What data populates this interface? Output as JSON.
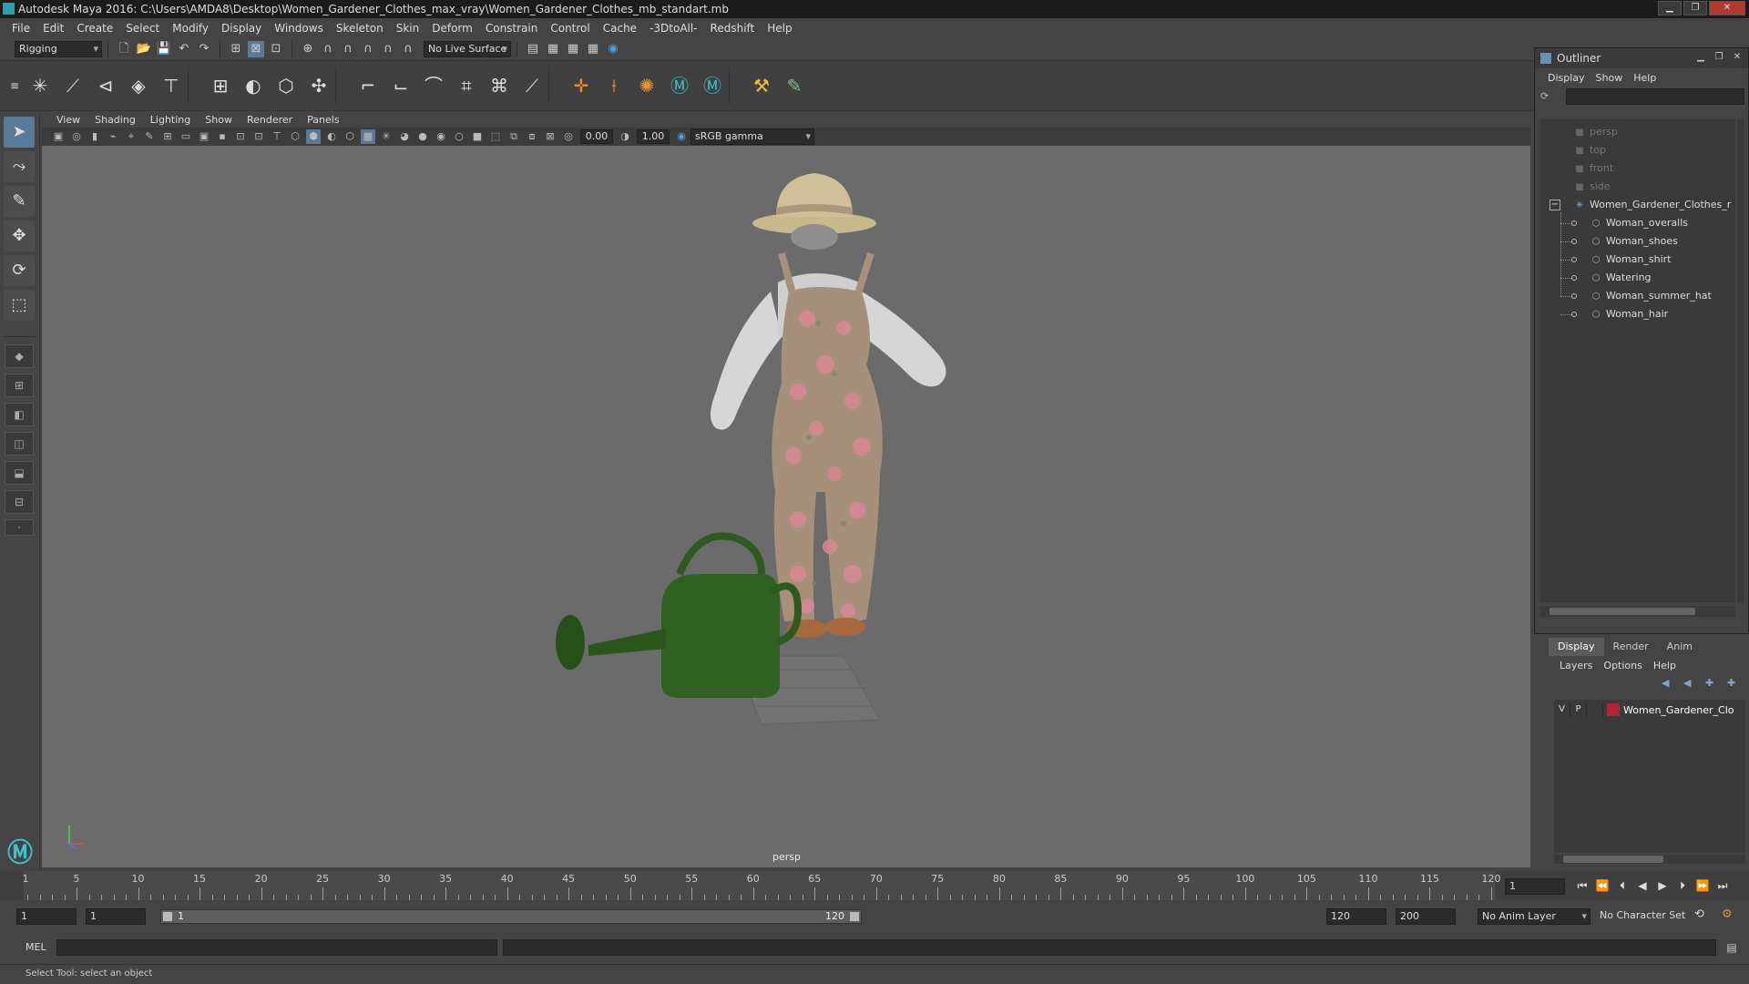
{
  "window": {
    "title": "Autodesk Maya 2016: C:\\Users\\AMDA8\\Desktop\\Women_Gardener_Clothes_max_vray\\Women_Gardener_Clothes_mb_standart.mb"
  },
  "menubar": [
    "File",
    "Edit",
    "Create",
    "Select",
    "Modify",
    "Display",
    "Windows",
    "Skeleton",
    "Skin",
    "Deform",
    "Constrain",
    "Control",
    "Cache",
    "-3DtoAll-",
    "Redshift",
    "Help"
  ],
  "statusline": {
    "menuset": "Rigging",
    "live_surface": "No Live Surface"
  },
  "panel": {
    "menus": [
      "View",
      "Shading",
      "Lighting",
      "Show",
      "Renderer",
      "Panels"
    ],
    "exposure": "0.00",
    "gamma": "1.00",
    "colorspace": "sRGB gamma",
    "camera_label": "persp"
  },
  "timeline": {
    "ticks": [
      "5",
      "10",
      "15",
      "20",
      "25",
      "30",
      "35",
      "40",
      "45",
      "50",
      "55",
      "60",
      "65",
      "70",
      "75",
      "80",
      "85",
      "90",
      "95",
      "100",
      "105",
      "110",
      "115",
      "120"
    ],
    "current_frame": "1"
  },
  "range": {
    "start": "1",
    "playback_start": "1",
    "slider_start": "1",
    "slider_end": "120",
    "playback_end": "120",
    "end": "200",
    "anim_layer": "No Anim Layer",
    "character_set": "No Character Set"
  },
  "mel": {
    "label": "MEL"
  },
  "status": {
    "help_line": "Select Tool: select an object"
  },
  "outliner": {
    "title": "Outliner",
    "menus": [
      "Display",
      "Show",
      "Help"
    ],
    "cameras": [
      "persp",
      "top",
      "front",
      "side"
    ],
    "group": "Women_Gardener_Clothes_r",
    "children": [
      "Woman_overalls",
      "Woman_shoes",
      "Woman_shirt",
      "Watering",
      "Woman_summer_hat",
      "Woman_hair"
    ]
  },
  "layers": {
    "tabs": [
      "Display",
      "Render",
      "Anim"
    ],
    "menus": [
      "Layers",
      "Options",
      "Help"
    ],
    "row": {
      "v": "V",
      "p": "P",
      "name": "Women_Gardener_Clo",
      "color": "#b0243a"
    }
  },
  "colors": {
    "viewport_bg": "#6b6b6b",
    "ui_bg": "#444444",
    "accent": "#5a7a9a"
  }
}
